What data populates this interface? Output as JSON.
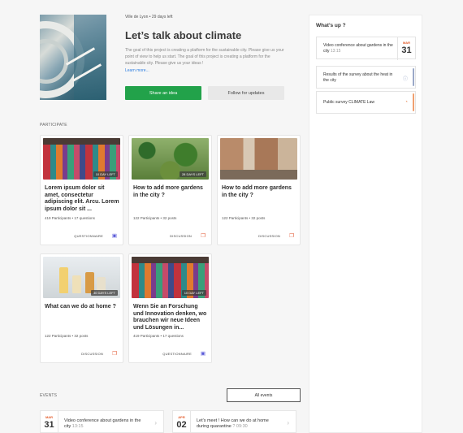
{
  "hero": {
    "meta": "Ville de Lyon • 29 days left",
    "title": "Let’s talk about climate",
    "description": "The goal of this project is creating a platform for the sustainable city. Please give us your point of view to help us start. The goal of this project is creating a platform for the sustainable city. Please give us your ideas !",
    "learn_more": "Learn more...",
    "share_button": "Share an idea",
    "follow_button": "Follow for updates"
  },
  "sidebar": {
    "title": "What’s up ?",
    "items": [
      {
        "text": "Video conference about gardens in the city",
        "time": "13:15",
        "month": "MAR",
        "day": "31"
      },
      {
        "text": "Results of the survey about the heat in the city",
        "icon": "info-icon"
      },
      {
        "text": "Public survey CLIMATE Law",
        "icon": "pie-chart-icon"
      }
    ],
    "colors": {
      "accent_orange": "#e35b2a",
      "bar_blue": "#9aa8c8",
      "bar_orange": "#f0a070"
    }
  },
  "participate": {
    "label": "PARTICIPATE",
    "cards": [
      {
        "days": "10 DAY LEFT",
        "title": "Lorem ipsum dolor sit amet, consectetur adipiscing elit. Arcu. Lorem ipsum dolor sit ...",
        "stats": "419 Participants • 17 questions",
        "type": "QUESTIONNAIRE",
        "icon": "questionnaire-icon"
      },
      {
        "days": "28 DAYS LEFT",
        "title": "How to add more gardens in the city ?",
        "stats": "122 Participants • 32 posts",
        "type": "DISCUSSION",
        "icon": "discussion-icon"
      },
      {
        "days": "1 DAY LEFT",
        "title": "How to add more gardens in the city ?",
        "stats": "122 Participants • 32 posts",
        "type": "DISCUSSION",
        "icon": "discussion-icon"
      },
      {
        "days": "30 DAYS LEFT",
        "title": "What can we do at home ?",
        "stats": "122 Participants • 32 posts",
        "type": "DISCUSSION",
        "icon": "discussion-icon"
      },
      {
        "days": "10 DAY LEFT",
        "title": "Wenn Sie an Forschung und Innovation denken, wo brauchen wir neue Ideen und Lösungen in...",
        "stats": "419 Participants • 17 questions",
        "type": "QUESTIONNAIRE",
        "icon": "questionnaire-icon"
      }
    ],
    "colors": {
      "green": "#22a24a",
      "discussion": "#e2532d",
      "questionnaire": "#5a5ad8"
    }
  },
  "events": {
    "label": "EVENTS",
    "all_button": "All events",
    "items": [
      {
        "month": "MAR",
        "day": "31",
        "text": "Video conference about gardens in the city",
        "time": "13:15"
      },
      {
        "month": "APR",
        "day": "02",
        "text": "Let's meet ! How can we do at home during quarantine",
        "time": "? 09:30"
      }
    ]
  }
}
